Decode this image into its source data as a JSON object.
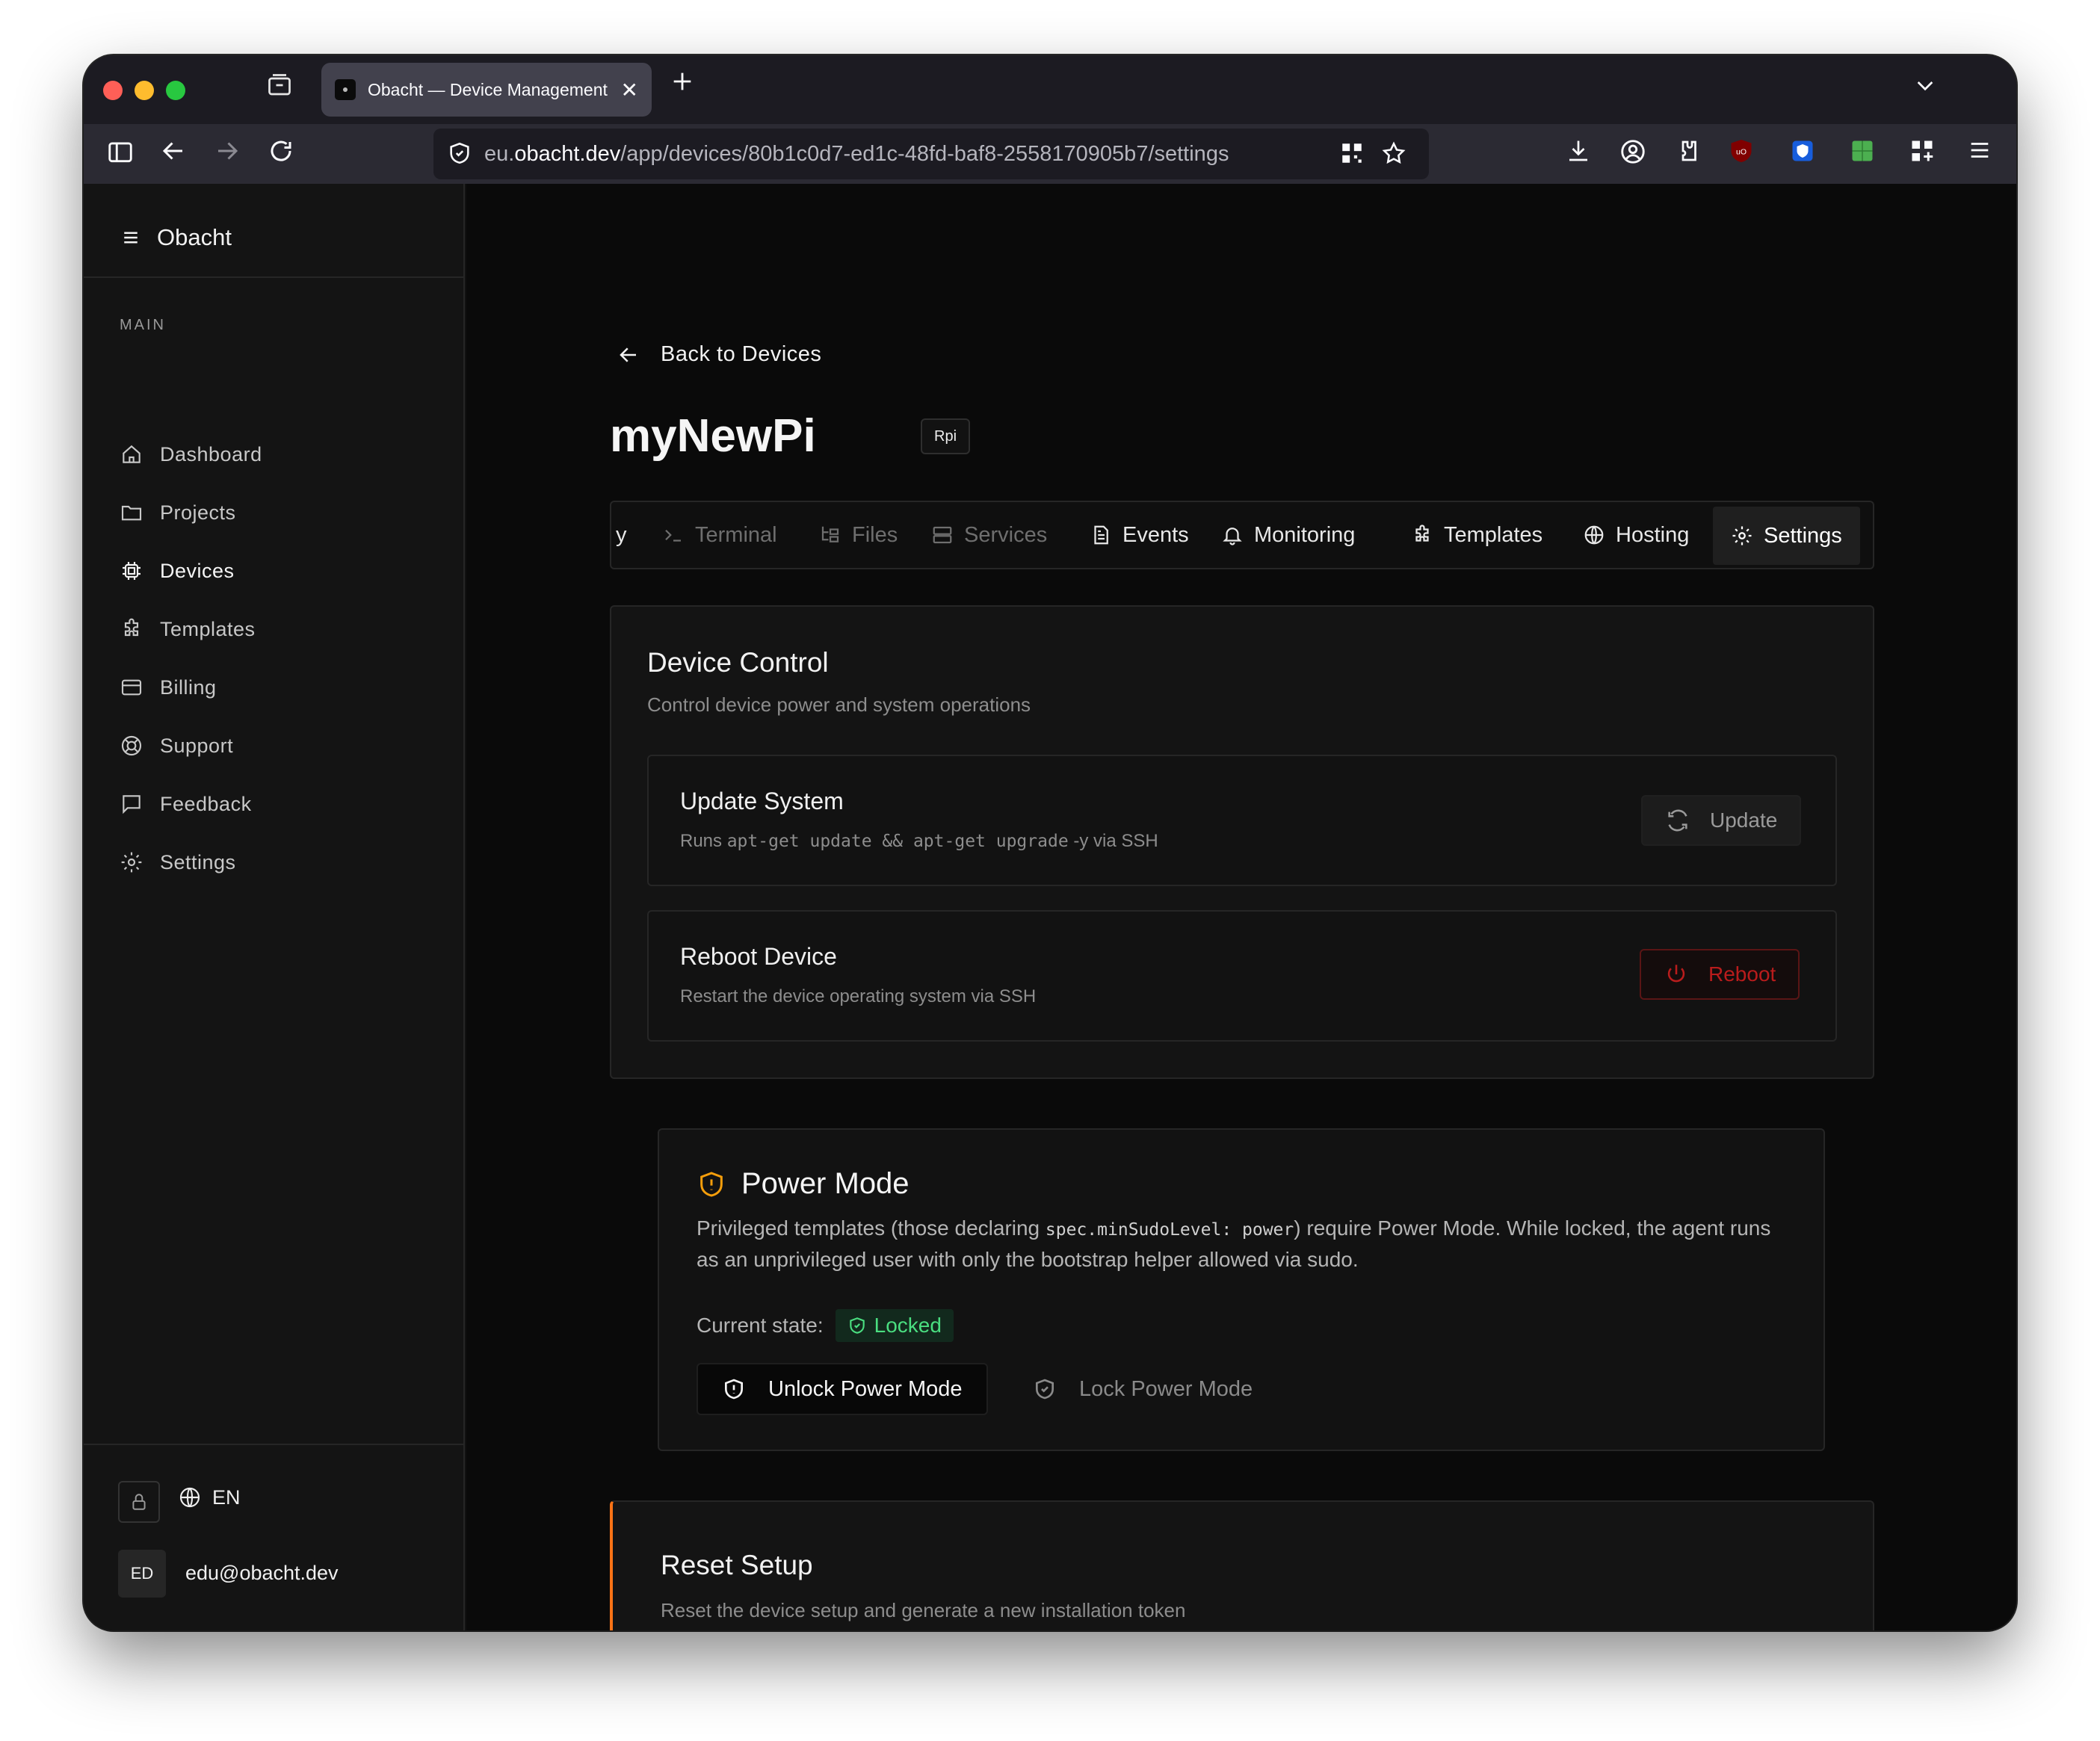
{
  "browser": {
    "tab_title": "Obacht — Device Management",
    "url_prefix": "eu.",
    "url_domain": "obacht.dev",
    "url_path": "/app/devices/80b1c0d7-ed1c-48fd-baf8-2558170905b7/settings"
  },
  "sidebar": {
    "brand": "Obacht",
    "section_label": "MAIN",
    "items": [
      {
        "label": "Dashboard"
      },
      {
        "label": "Projects"
      },
      {
        "label": "Devices"
      },
      {
        "label": "Templates"
      },
      {
        "label": "Billing"
      },
      {
        "label": "Support"
      },
      {
        "label": "Feedback"
      },
      {
        "label": "Settings"
      }
    ],
    "language": "EN",
    "avatar_initials": "ED",
    "user_email": "edu@obacht.dev"
  },
  "page": {
    "back_label": "Back to Devices",
    "device_name": "myNewPi",
    "device_badge": "Rpi",
    "tabs": {
      "clipped": "y",
      "terminal": "Terminal",
      "files": "Files",
      "services": "Services",
      "events": "Events",
      "monitoring": "Monitoring",
      "templates": "Templates",
      "hosting": "Hosting",
      "settings": "Settings"
    }
  },
  "device_control": {
    "title": "Device Control",
    "subtitle": "Control device power and system operations",
    "update": {
      "title": "Update System",
      "desc_prefix": "Runs ",
      "desc_code": "apt-get update && apt-get upgrade",
      "desc_suffix": " -y via SSH",
      "button": "Update"
    },
    "reboot": {
      "title": "Reboot Device",
      "desc": "Restart the device operating system via SSH",
      "button": "Reboot"
    }
  },
  "power_mode": {
    "title": "Power Mode",
    "desc_a": "Privileged templates (those declaring ",
    "desc_code": "spec.minSudoLevel: power",
    "desc_b": ") require Power Mode. While locked, the agent runs as an unprivileged user with only the bootstrap helper allowed via sudo.",
    "state_label": "Current state:",
    "state_value": "Locked",
    "unlock_button": "Unlock Power Mode",
    "lock_button": "Lock Power Mode"
  },
  "reset_setup": {
    "title": "Reset Setup",
    "subtitle": "Reset the device setup and generate a new installation token"
  },
  "colors": {
    "accent_orange": "#f97316",
    "locked_green": "#4ade80",
    "reboot_red": "#dc2626",
    "power_icon": "#f59e0b"
  }
}
